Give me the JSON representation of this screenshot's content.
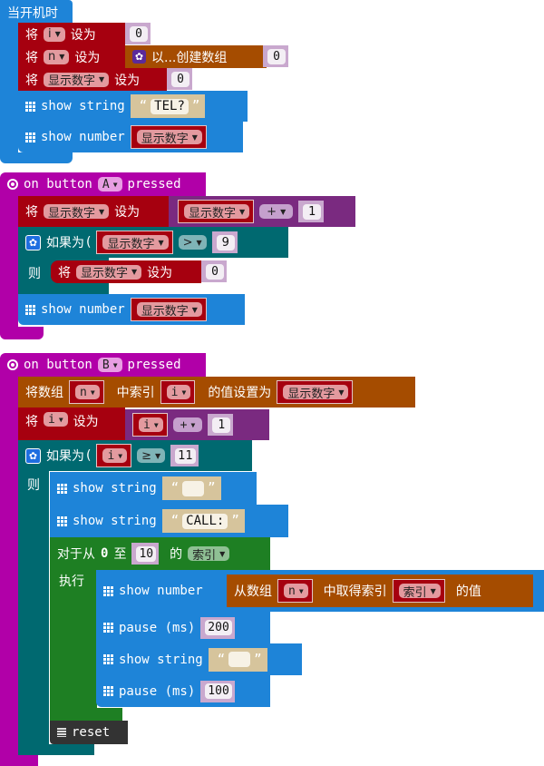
{
  "on_start": {
    "hat": "当开机时",
    "set_i": {
      "prefix": "将",
      "var": "i",
      "suffix": "设为",
      "value": "0"
    },
    "set_n": {
      "prefix": "将",
      "var": "n",
      "suffix": "设为",
      "create_label": "以...创建数组",
      "value": "0"
    },
    "set_disp": {
      "prefix": "将",
      "var": "显示数字",
      "suffix": "设为",
      "value": "0"
    },
    "show_string": {
      "label": "show string",
      "open_quote": "“",
      "value": "TEL?",
      "close_quote": "”"
    },
    "show_number": {
      "label": "show number",
      "var": "显示数字"
    }
  },
  "on_a": {
    "hat_prefix": "on button",
    "button": "A",
    "hat_suffix": "pressed",
    "set_disp": {
      "prefix": "将",
      "var": "显示数字",
      "suffix": "设为",
      "operand": "显示数字",
      "op": "+",
      "value": "1"
    },
    "if": {
      "label": "如果为",
      "operand": "显示数字",
      "op": ">",
      "value": "9",
      "then": "则"
    },
    "then_set": {
      "prefix": "将",
      "var": "显示数字",
      "suffix": "设为",
      "value": "0"
    },
    "show_number": {
      "label": "show number",
      "var": "显示数字"
    }
  },
  "on_b": {
    "hat_prefix": "on button",
    "button": "B",
    "hat_suffix": "pressed",
    "array_set": {
      "prefix": "将数组",
      "array": "n",
      "mid": "中索引",
      "index": "i",
      "suffix": "的值设置为",
      "value": "显示数字"
    },
    "set_i": {
      "prefix": "将",
      "var": "i",
      "suffix": "设为",
      "operand": "i",
      "op": "+",
      "value": "1"
    },
    "if": {
      "label": "如果为",
      "operand": "i",
      "op": "≥",
      "value": "11",
      "then": "则"
    },
    "show_string_1": {
      "label": "show string",
      "open_quote": "“",
      "value": "",
      "close_quote": "”"
    },
    "show_string_2": {
      "label": "show string",
      "open_quote": "“",
      "value": "CALL:",
      "close_quote": "”"
    },
    "for": {
      "prefix": "对于从",
      "from": "0",
      "to_label": "至",
      "to": "10",
      "of": "的",
      "var": "索引",
      "do": "执行"
    },
    "loop_show_number": {
      "label": "show number",
      "get_prefix": "从数组",
      "array": "n",
      "get_mid": "中取得索引",
      "index": "索引",
      "get_suffix": "的值"
    },
    "pause_1": {
      "label": "pause (ms)",
      "value": "200"
    },
    "loop_show_string": {
      "label": "show string",
      "open_quote": "“",
      "value": "",
      "close_quote": "”"
    },
    "pause_2": {
      "label": "pause (ms)",
      "value": "100"
    },
    "reset": {
      "label": "reset"
    }
  }
}
